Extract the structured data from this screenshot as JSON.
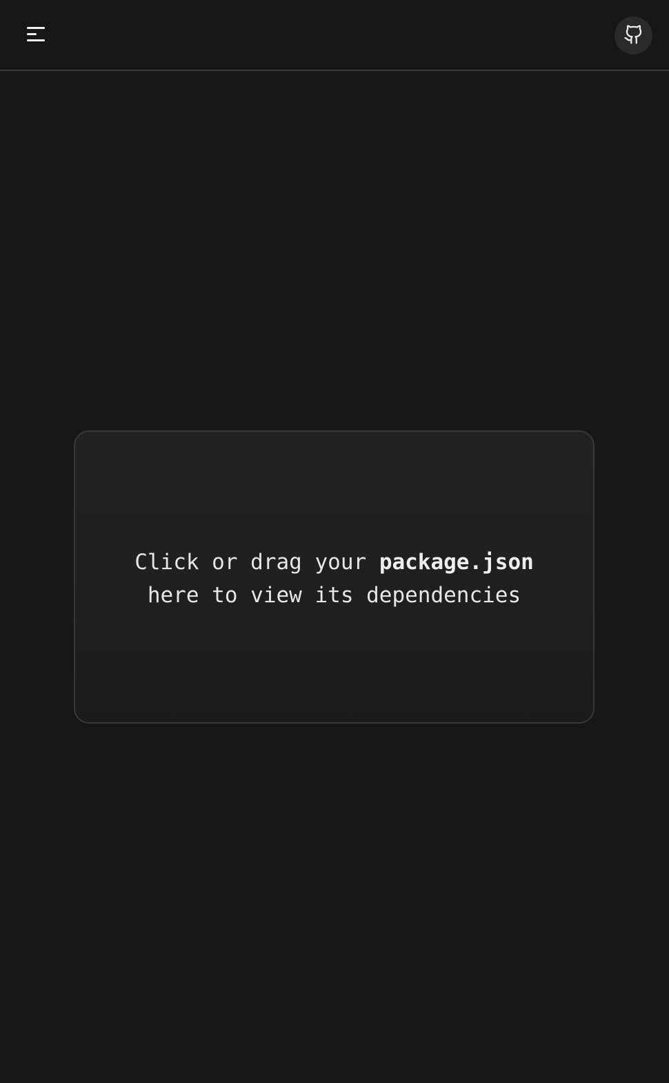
{
  "header": {
    "menu_icon": "hamburger-menu-icon",
    "github_icon": "github-icon"
  },
  "dropzone": {
    "text_before": "Click or drag your ",
    "filename": "package.json",
    "text_after": "here to view its dependencies"
  },
  "colors": {
    "background": "#171717",
    "card": "#202020",
    "text": "#e6e6e6",
    "github_button_bg": "#2a2a2a"
  }
}
